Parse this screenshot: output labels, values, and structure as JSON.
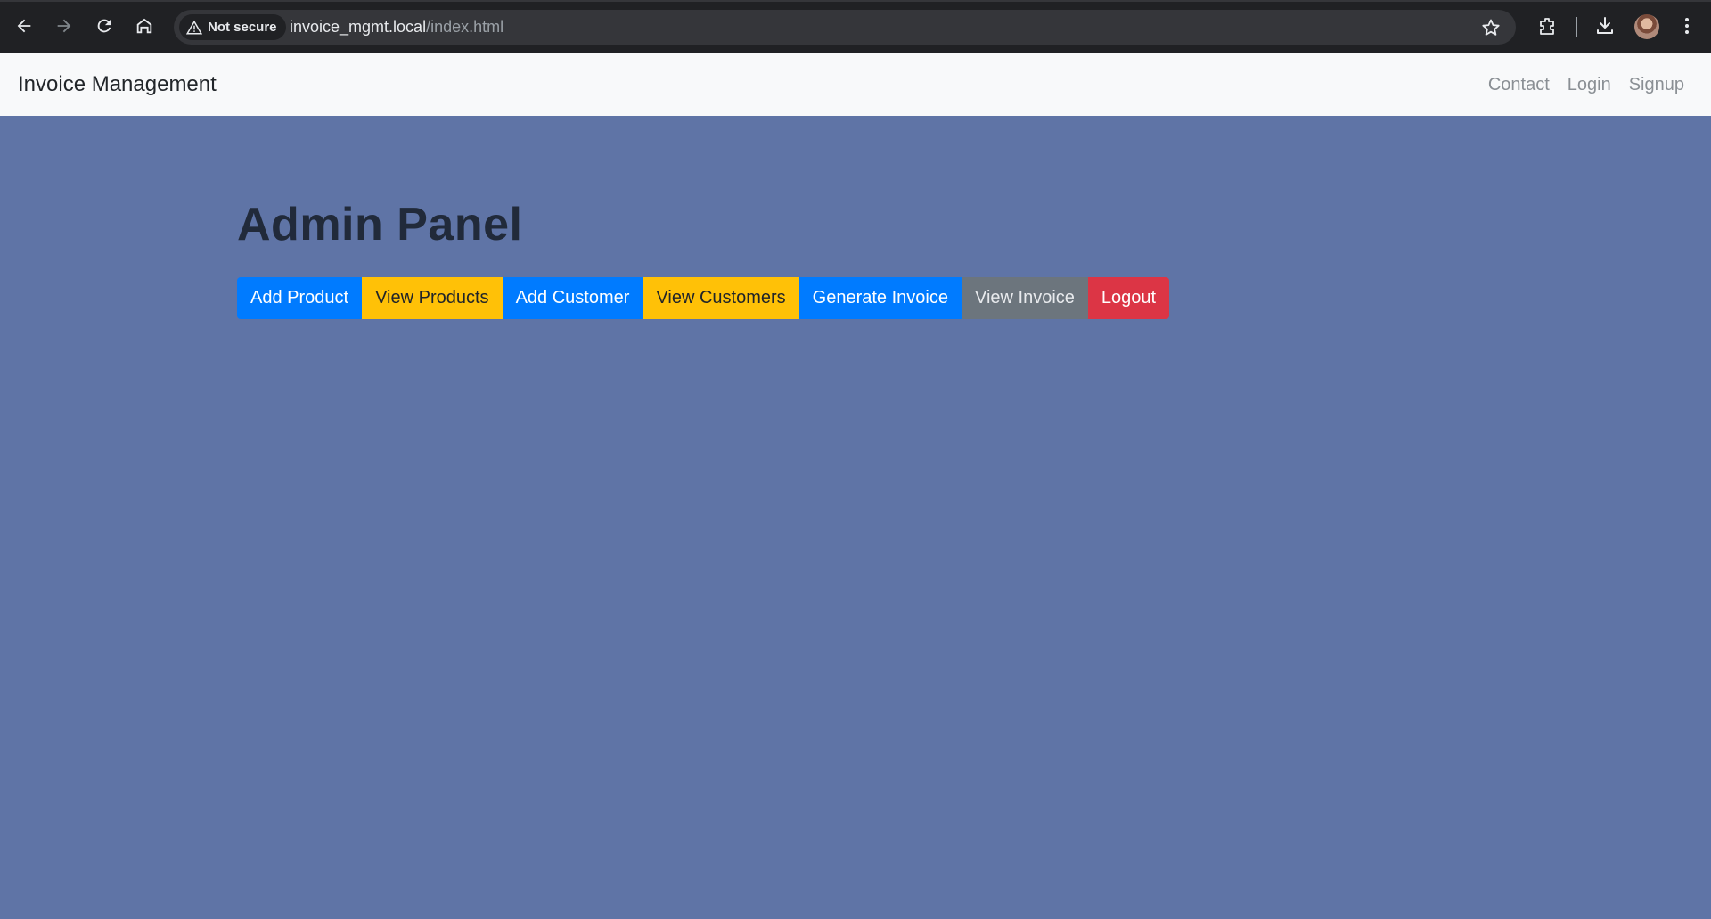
{
  "browser": {
    "security_label": "Not secure",
    "url_host": "invoice_mgmt.local",
    "url_path": "/index.html"
  },
  "navbar": {
    "brand": "Invoice Management",
    "links": [
      "Contact",
      "Login",
      "Signup"
    ]
  },
  "main": {
    "title": "Admin Panel",
    "buttons": [
      {
        "label": "Add Product",
        "variant": "primary"
      },
      {
        "label": "View Products",
        "variant": "warning"
      },
      {
        "label": "Add Customer",
        "variant": "primary"
      },
      {
        "label": "View Customers",
        "variant": "warning"
      },
      {
        "label": "Generate Invoice",
        "variant": "primary"
      },
      {
        "label": "View Invoice",
        "variant": "secondary"
      },
      {
        "label": "Logout",
        "variant": "danger"
      }
    ]
  },
  "colors": {
    "page_background": "#5f74a6",
    "primary": "#007bff",
    "warning": "#ffc107",
    "secondary": "#6c757d",
    "danger": "#dc3545"
  },
  "icons": [
    "back-arrow-icon",
    "forward-arrow-icon",
    "reload-icon",
    "home-icon",
    "warning-triangle-icon",
    "star-icon",
    "extensions-icon",
    "download-icon",
    "kebab-menu-icon"
  ]
}
